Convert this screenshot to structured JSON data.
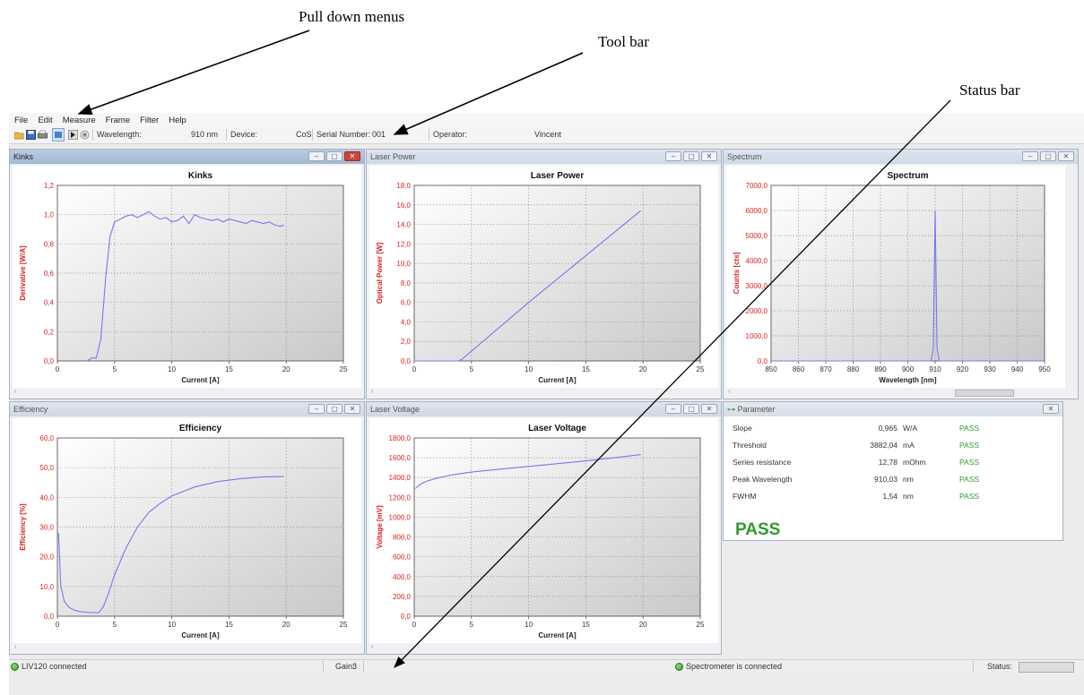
{
  "annotations": {
    "menus": "Pull down menus",
    "toolbar": "Tool bar",
    "statusbar": "Status bar"
  },
  "menu": [
    "File",
    "Edit",
    "Measure",
    "Frame",
    "Filter",
    "Help"
  ],
  "toolbar": {
    "icons": [
      "open-folder-icon",
      "save-icon",
      "print-icon",
      "measure-icon",
      "play-icon",
      "stop-icon"
    ],
    "wavelength_label": "Wavelength:",
    "wavelength_value": "910 nm",
    "device_label": "Device:",
    "device_value": "CoS",
    "serial_label": "Serial Number:",
    "serial_value": "001",
    "operator_label": "Operator:",
    "operator_value": "Vincent"
  },
  "windows": {
    "kinks": {
      "title": "Kinks",
      "chart_data": {
        "type": "line",
        "title": "Kinks",
        "xlabel": "Current [A]",
        "ylabel": "Derivative [W/A]",
        "xlim": [
          0,
          25
        ],
        "ylim": [
          0,
          1.2
        ],
        "xticks": [
          0,
          5,
          10,
          15,
          20,
          25
        ],
        "yticks": [
          "0,0",
          "0,2",
          "0,4",
          "0,6",
          "0,8",
          "1,0",
          "1,2"
        ],
        "grid": true,
        "x": [
          2.6,
          3.0,
          3.4,
          3.8,
          4.2,
          4.6,
          5.0,
          5.5,
          6.0,
          6.5,
          7.0,
          7.5,
          8.0,
          8.5,
          9.0,
          9.5,
          10.0,
          10.5,
          11.0,
          11.5,
          12.0,
          12.5,
          13.0,
          13.5,
          14.0,
          14.5,
          15.0,
          15.5,
          16.0,
          16.5,
          17.0,
          17.5,
          18.0,
          18.5,
          19.0,
          19.5,
          19.8
        ],
        "y": [
          0.0,
          0.02,
          0.02,
          0.15,
          0.55,
          0.85,
          0.95,
          0.97,
          0.99,
          1.0,
          0.98,
          1.0,
          1.02,
          0.99,
          0.97,
          0.98,
          0.95,
          0.96,
          0.99,
          0.94,
          1.0,
          0.98,
          0.97,
          0.96,
          0.97,
          0.95,
          0.97,
          0.96,
          0.95,
          0.94,
          0.96,
          0.95,
          0.94,
          0.95,
          0.93,
          0.92,
          0.93
        ]
      }
    },
    "laser_power": {
      "title": "Laser Power",
      "chart_data": {
        "type": "line",
        "title": "Laser Power",
        "xlabel": "Current [A]",
        "ylabel": "Optical Power [W]",
        "xlim": [
          0,
          25
        ],
        "ylim": [
          0,
          18
        ],
        "xticks": [
          0,
          5,
          10,
          15,
          20,
          25
        ],
        "yticks": [
          "0,0",
          "2,0",
          "4,0",
          "6,0",
          "8,0",
          "10,0",
          "12,0",
          "14,0",
          "16,0",
          "18,0"
        ],
        "grid": true,
        "x": [
          0,
          3.9,
          4.2,
          5,
          10,
          15,
          19.8
        ],
        "y": [
          0.0,
          0.0,
          0.2,
          1.0,
          6.0,
          10.8,
          15.4
        ]
      }
    },
    "spectrum": {
      "title": "Spectrum",
      "chart_data": {
        "type": "line",
        "title": "Spectrum",
        "xlabel": "Wavelength [nm]",
        "ylabel": "Counts [cts]",
        "xlim": [
          850,
          950
        ],
        "ylim": [
          0,
          7000
        ],
        "xticks": [
          850,
          860,
          870,
          880,
          890,
          900,
          910,
          920,
          930,
          940,
          950
        ],
        "yticks": [
          "0,0",
          "1000,0",
          "2000,0",
          "3000,0",
          "4000,0",
          "5000,0",
          "6000,0",
          "7000,0"
        ],
        "grid": true,
        "x": [
          850,
          908.5,
          909.3,
          910.0,
          910.7,
          911.5,
          950
        ],
        "y": [
          0,
          0,
          500,
          6000,
          500,
          0,
          0
        ]
      }
    },
    "efficiency": {
      "title": "Efficiency",
      "chart_data": {
        "type": "line",
        "title": "Efficiency",
        "xlabel": "Current [A]",
        "ylabel": "Efficiency [%]",
        "xlim": [
          0,
          25
        ],
        "ylim": [
          0,
          60
        ],
        "xticks": [
          0,
          5,
          10,
          15,
          20,
          25
        ],
        "yticks": [
          "0,0",
          "10,0",
          "20,0",
          "30,0",
          "40,0",
          "50,0",
          "60,0"
        ],
        "grid": true,
        "x": [
          0.1,
          0.3,
          0.6,
          1.0,
          1.5,
          2.0,
          3.0,
          3.6,
          4.0,
          4.5,
          5.0,
          6.0,
          7.0,
          8.0,
          9.0,
          10.0,
          11.0,
          12.0,
          14.0,
          16.0,
          18.0,
          19.8
        ],
        "y": [
          28,
          10,
          5,
          3,
          2,
          1.5,
          1.2,
          1.2,
          3,
          8,
          14,
          23,
          30,
          35,
          38,
          40.5,
          42,
          43.5,
          45.3,
          46.3,
          46.9,
          47.0
        ]
      }
    },
    "laser_voltage": {
      "title": "Laser Voltage",
      "chart_data": {
        "type": "line",
        "title": "Laser Voltage",
        "xlabel": "Current [A]",
        "ylabel": "Voltage [mV]",
        "xlim": [
          0,
          25
        ],
        "ylim": [
          0,
          1800
        ],
        "xticks": [
          0,
          5,
          10,
          15,
          20,
          25
        ],
        "yticks": [
          "0,0",
          "200,0",
          "400,0",
          "600,0",
          "800,0",
          "1000,0",
          "1200,0",
          "1400,0",
          "1600,0",
          "1800,0"
        ],
        "grid": true,
        "x": [
          0.1,
          0.5,
          1.0,
          2.0,
          3.0,
          4.0,
          5.0,
          7.5,
          10.0,
          12.5,
          15.0,
          17.5,
          19.8
        ],
        "y": [
          1290,
          1330,
          1360,
          1395,
          1420,
          1440,
          1455,
          1485,
          1512,
          1540,
          1568,
          1600,
          1632
        ]
      }
    },
    "parameter": {
      "title": "Parameter",
      "rows": [
        {
          "name": "Slope",
          "value": "0,965",
          "unit": "W/A",
          "result": "PASS"
        },
        {
          "name": "Threshold",
          "value": "3882,04",
          "unit": "mA",
          "result": "PASS"
        },
        {
          "name": "Series resistance",
          "value": "12,78",
          "unit": "mOhm",
          "result": "PASS"
        },
        {
          "name": "Peak Wavelength",
          "value": "910,03",
          "unit": "nm",
          "result": "PASS"
        },
        {
          "name": "FWHM",
          "value": "1,54",
          "unit": "nm",
          "result": "PASS"
        }
      ],
      "overall": "PASS",
      "pass_color": "#2e9a2e"
    }
  },
  "status": {
    "connection": "LIV120 connected",
    "gain_label": "Gain:",
    "gain_value": "3",
    "spectrometer": "Spectrometer is connected",
    "status_label": "Status:"
  },
  "colors": {
    "curve": "#7777ee",
    "axis_label": "#dd2222",
    "tick_label": "#dd2222"
  }
}
